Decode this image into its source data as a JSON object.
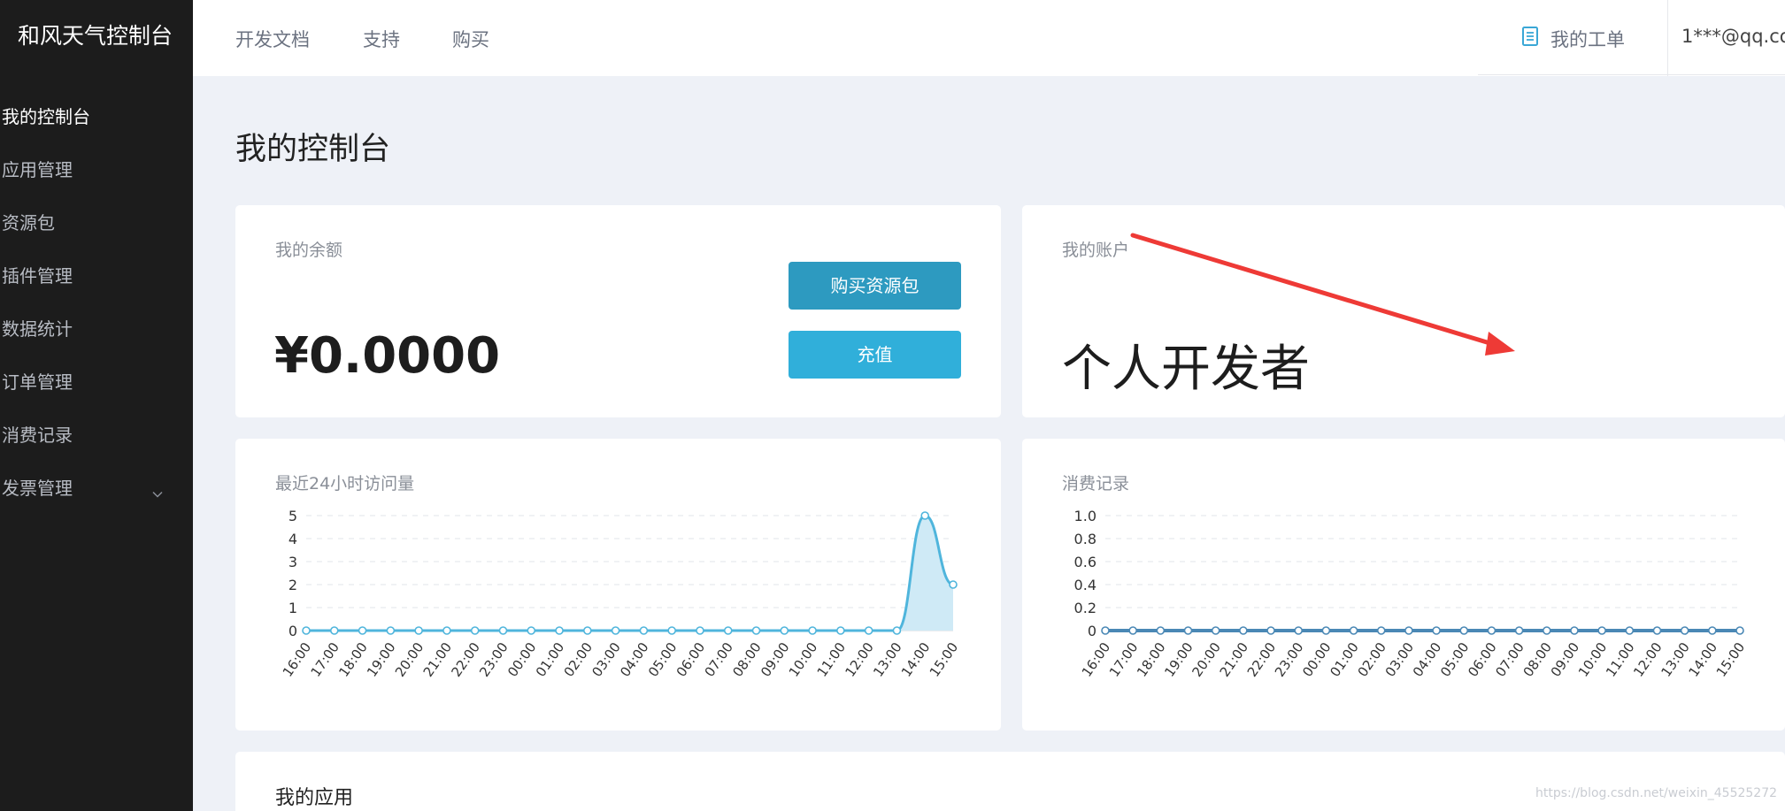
{
  "sidebar": {
    "brand": "和风天气控制台",
    "items": [
      {
        "label": "我的控制台"
      },
      {
        "label": "应用管理"
      },
      {
        "label": "资源包"
      },
      {
        "label": "插件管理"
      },
      {
        "label": "数据统计"
      },
      {
        "label": "订单管理"
      },
      {
        "label": "消费记录"
      },
      {
        "label": "发票管理"
      }
    ]
  },
  "topbar": {
    "links": [
      "开发文档",
      "支持",
      "购买"
    ],
    "ticket_label": "我的工单",
    "user": "1***@qq.co"
  },
  "page": {
    "title": "我的控制台"
  },
  "balance_card": {
    "label": "我的余额",
    "amount": "¥0.0000",
    "buy_button": "购买资源包",
    "recharge_button": "充值"
  },
  "account_card": {
    "label": "我的账户",
    "type": "个人开发者"
  },
  "apps_section": {
    "title": "我的应用"
  },
  "watermark": "https://blog.csdn.net/weixin_45525272",
  "colors": {
    "sidebar_bg": "#1c1c1c",
    "page_bg": "#eef1f7",
    "btn_dark": "#2d9ac0",
    "btn_light": "#30afda",
    "visits_line": "#4fb5dc",
    "visits_fill": "#cfeaf6",
    "consumption_line": "#4a88b5",
    "annotation_arrow": "#ee3a36"
  },
  "chart_data": [
    {
      "type": "area",
      "title": "最近24小时访问量",
      "categories": [
        "16:00",
        "17:00",
        "18:00",
        "19:00",
        "20:00",
        "21:00",
        "22:00",
        "23:00",
        "00:00",
        "01:00",
        "02:00",
        "03:00",
        "04:00",
        "05:00",
        "06:00",
        "07:00",
        "08:00",
        "09:00",
        "10:00",
        "11:00",
        "12:00",
        "13:00",
        "14:00",
        "15:00"
      ],
      "series": [
        {
          "values": [
            0,
            0,
            0,
            0,
            0,
            0,
            0,
            0,
            0,
            0,
            0,
            0,
            0,
            0,
            0,
            0,
            0,
            0,
            0,
            0,
            0,
            0,
            5,
            2
          ]
        }
      ],
      "yticks": [
        "0",
        "1",
        "2",
        "3",
        "4",
        "5"
      ],
      "ylim": [
        0,
        5
      ],
      "grid": true
    },
    {
      "type": "line",
      "title": "消费记录",
      "categories": [
        "16:00",
        "17:00",
        "18:00",
        "19:00",
        "20:00",
        "21:00",
        "22:00",
        "23:00",
        "00:00",
        "01:00",
        "02:00",
        "03:00",
        "04:00",
        "05:00",
        "06:00",
        "07:00",
        "08:00",
        "09:00",
        "10:00",
        "11:00",
        "12:00",
        "13:00",
        "14:00",
        "15:00"
      ],
      "series": [
        {
          "values": [
            0,
            0,
            0,
            0,
            0,
            0,
            0,
            0,
            0,
            0,
            0,
            0,
            0,
            0,
            0,
            0,
            0,
            0,
            0,
            0,
            0,
            0,
            0,
            0
          ]
        }
      ],
      "yticks": [
        "0",
        "0.2",
        "0.4",
        "0.6",
        "0.8",
        "1.0"
      ],
      "ylim": [
        0,
        1
      ],
      "grid": true
    }
  ]
}
